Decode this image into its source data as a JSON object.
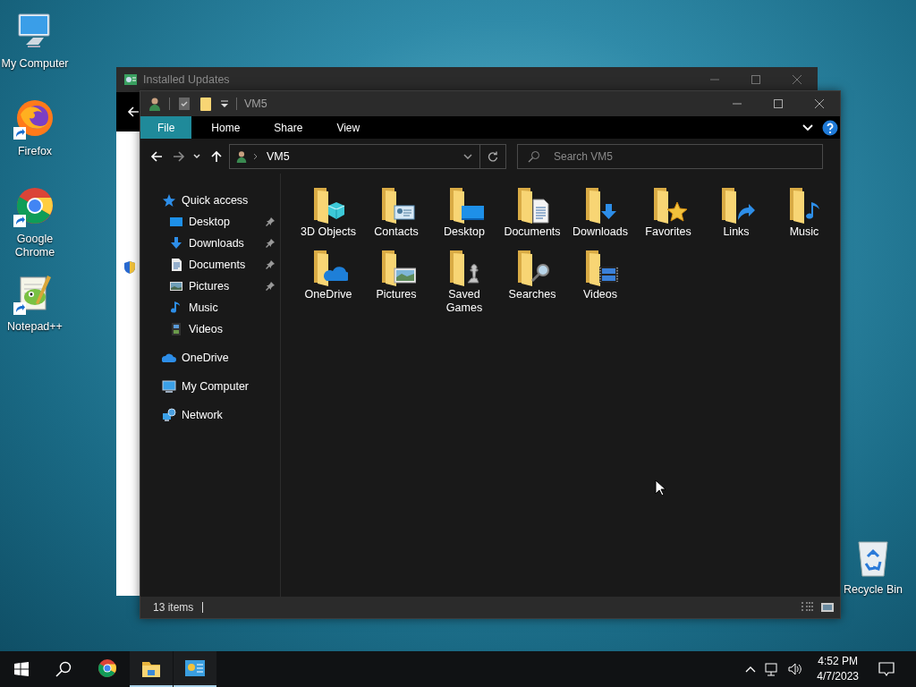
{
  "desktop_icons": [
    {
      "label": "My Computer",
      "kind": "computer",
      "shortcut": false
    },
    {
      "label": "Firefox",
      "kind": "firefox",
      "shortcut": true
    },
    {
      "label": "Google Chrome",
      "kind": "chrome",
      "shortcut": true
    },
    {
      "label": "Notepad++",
      "kind": "notepad",
      "shortcut": true
    }
  ],
  "recycle_bin": {
    "label": "Recycle Bin"
  },
  "background_window": {
    "title": "Installed Updates"
  },
  "explorer": {
    "title": "VM5",
    "ribbon_tabs": [
      {
        "label": "File",
        "selected": true
      },
      {
        "label": "Home",
        "selected": false
      },
      {
        "label": "Share",
        "selected": false
      },
      {
        "label": "View",
        "selected": false
      }
    ],
    "address": {
      "path": "VM5"
    },
    "search": {
      "placeholder": "Search VM5"
    },
    "navigation": [
      {
        "label": "Quick access",
        "kind": "star",
        "children": [
          {
            "label": "Desktop",
            "kind": "desktop",
            "pinned": true
          },
          {
            "label": "Downloads",
            "kind": "downloads",
            "pinned": true
          },
          {
            "label": "Documents",
            "kind": "documents",
            "pinned": true
          },
          {
            "label": "Pictures",
            "kind": "pictures",
            "pinned": true
          },
          {
            "label": "Music",
            "kind": "music",
            "pinned": false
          },
          {
            "label": "Videos",
            "kind": "videos",
            "pinned": false
          }
        ]
      },
      {
        "label": "OneDrive",
        "kind": "onedrive"
      },
      {
        "label": "My Computer",
        "kind": "computer"
      },
      {
        "label": "Network",
        "kind": "network"
      }
    ],
    "items": [
      {
        "label": "3D Objects",
        "kind": "cube"
      },
      {
        "label": "Contacts",
        "kind": "contacts"
      },
      {
        "label": "Desktop",
        "kind": "desktop"
      },
      {
        "label": "Documents",
        "kind": "documents"
      },
      {
        "label": "Downloads",
        "kind": "downloads"
      },
      {
        "label": "Favorites",
        "kind": "star"
      },
      {
        "label": "Links",
        "kind": "links"
      },
      {
        "label": "Music",
        "kind": "music"
      },
      {
        "label": "OneDrive",
        "kind": "onedrive"
      },
      {
        "label": "Pictures",
        "kind": "pictures"
      },
      {
        "label": "Saved Games",
        "kind": "chess"
      },
      {
        "label": "Searches",
        "kind": "search"
      },
      {
        "label": "Videos",
        "kind": "videos"
      }
    ],
    "status": {
      "count": "13 items"
    }
  },
  "taskbar": {
    "apps": [
      {
        "kind": "chrome",
        "running": false
      },
      {
        "kind": "explorer",
        "running": true
      },
      {
        "kind": "control",
        "running": true
      }
    ],
    "time": "4:52 PM",
    "date": "4/7/2023"
  }
}
